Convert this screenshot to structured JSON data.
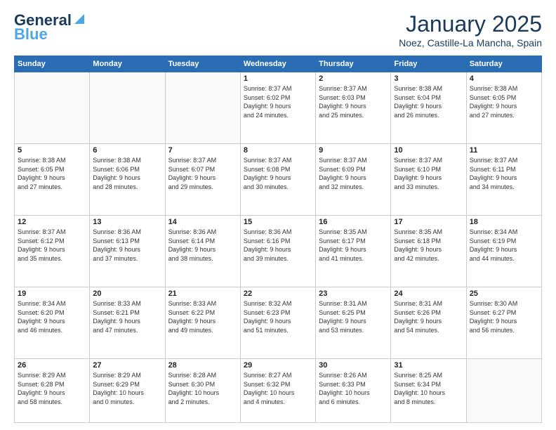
{
  "logo": {
    "line1": "General",
    "line2": "Blue"
  },
  "header": {
    "month": "January 2025",
    "location": "Noez, Castille-La Mancha, Spain"
  },
  "weekdays": [
    "Sunday",
    "Monday",
    "Tuesday",
    "Wednesday",
    "Thursday",
    "Friday",
    "Saturday"
  ],
  "weeks": [
    [
      {
        "day": "",
        "info": ""
      },
      {
        "day": "",
        "info": ""
      },
      {
        "day": "",
        "info": ""
      },
      {
        "day": "1",
        "info": "Sunrise: 8:37 AM\nSunset: 6:02 PM\nDaylight: 9 hours\nand 24 minutes."
      },
      {
        "day": "2",
        "info": "Sunrise: 8:37 AM\nSunset: 6:03 PM\nDaylight: 9 hours\nand 25 minutes."
      },
      {
        "day": "3",
        "info": "Sunrise: 8:38 AM\nSunset: 6:04 PM\nDaylight: 9 hours\nand 26 minutes."
      },
      {
        "day": "4",
        "info": "Sunrise: 8:38 AM\nSunset: 6:05 PM\nDaylight: 9 hours\nand 27 minutes."
      }
    ],
    [
      {
        "day": "5",
        "info": "Sunrise: 8:38 AM\nSunset: 6:05 PM\nDaylight: 9 hours\nand 27 minutes."
      },
      {
        "day": "6",
        "info": "Sunrise: 8:38 AM\nSunset: 6:06 PM\nDaylight: 9 hours\nand 28 minutes."
      },
      {
        "day": "7",
        "info": "Sunrise: 8:37 AM\nSunset: 6:07 PM\nDaylight: 9 hours\nand 29 minutes."
      },
      {
        "day": "8",
        "info": "Sunrise: 8:37 AM\nSunset: 6:08 PM\nDaylight: 9 hours\nand 30 minutes."
      },
      {
        "day": "9",
        "info": "Sunrise: 8:37 AM\nSunset: 6:09 PM\nDaylight: 9 hours\nand 32 minutes."
      },
      {
        "day": "10",
        "info": "Sunrise: 8:37 AM\nSunset: 6:10 PM\nDaylight: 9 hours\nand 33 minutes."
      },
      {
        "day": "11",
        "info": "Sunrise: 8:37 AM\nSunset: 6:11 PM\nDaylight: 9 hours\nand 34 minutes."
      }
    ],
    [
      {
        "day": "12",
        "info": "Sunrise: 8:37 AM\nSunset: 6:12 PM\nDaylight: 9 hours\nand 35 minutes."
      },
      {
        "day": "13",
        "info": "Sunrise: 8:36 AM\nSunset: 6:13 PM\nDaylight: 9 hours\nand 37 minutes."
      },
      {
        "day": "14",
        "info": "Sunrise: 8:36 AM\nSunset: 6:14 PM\nDaylight: 9 hours\nand 38 minutes."
      },
      {
        "day": "15",
        "info": "Sunrise: 8:36 AM\nSunset: 6:16 PM\nDaylight: 9 hours\nand 39 minutes."
      },
      {
        "day": "16",
        "info": "Sunrise: 8:35 AM\nSunset: 6:17 PM\nDaylight: 9 hours\nand 41 minutes."
      },
      {
        "day": "17",
        "info": "Sunrise: 8:35 AM\nSunset: 6:18 PM\nDaylight: 9 hours\nand 42 minutes."
      },
      {
        "day": "18",
        "info": "Sunrise: 8:34 AM\nSunset: 6:19 PM\nDaylight: 9 hours\nand 44 minutes."
      }
    ],
    [
      {
        "day": "19",
        "info": "Sunrise: 8:34 AM\nSunset: 6:20 PM\nDaylight: 9 hours\nand 46 minutes."
      },
      {
        "day": "20",
        "info": "Sunrise: 8:33 AM\nSunset: 6:21 PM\nDaylight: 9 hours\nand 47 minutes."
      },
      {
        "day": "21",
        "info": "Sunrise: 8:33 AM\nSunset: 6:22 PM\nDaylight: 9 hours\nand 49 minutes."
      },
      {
        "day": "22",
        "info": "Sunrise: 8:32 AM\nSunset: 6:23 PM\nDaylight: 9 hours\nand 51 minutes."
      },
      {
        "day": "23",
        "info": "Sunrise: 8:31 AM\nSunset: 6:25 PM\nDaylight: 9 hours\nand 53 minutes."
      },
      {
        "day": "24",
        "info": "Sunrise: 8:31 AM\nSunset: 6:26 PM\nDaylight: 9 hours\nand 54 minutes."
      },
      {
        "day": "25",
        "info": "Sunrise: 8:30 AM\nSunset: 6:27 PM\nDaylight: 9 hours\nand 56 minutes."
      }
    ],
    [
      {
        "day": "26",
        "info": "Sunrise: 8:29 AM\nSunset: 6:28 PM\nDaylight: 9 hours\nand 58 minutes."
      },
      {
        "day": "27",
        "info": "Sunrise: 8:29 AM\nSunset: 6:29 PM\nDaylight: 10 hours\nand 0 minutes."
      },
      {
        "day": "28",
        "info": "Sunrise: 8:28 AM\nSunset: 6:30 PM\nDaylight: 10 hours\nand 2 minutes."
      },
      {
        "day": "29",
        "info": "Sunrise: 8:27 AM\nSunset: 6:32 PM\nDaylight: 10 hours\nand 4 minutes."
      },
      {
        "day": "30",
        "info": "Sunrise: 8:26 AM\nSunset: 6:33 PM\nDaylight: 10 hours\nand 6 minutes."
      },
      {
        "day": "31",
        "info": "Sunrise: 8:25 AM\nSunset: 6:34 PM\nDaylight: 10 hours\nand 8 minutes."
      },
      {
        "day": "",
        "info": ""
      }
    ]
  ]
}
